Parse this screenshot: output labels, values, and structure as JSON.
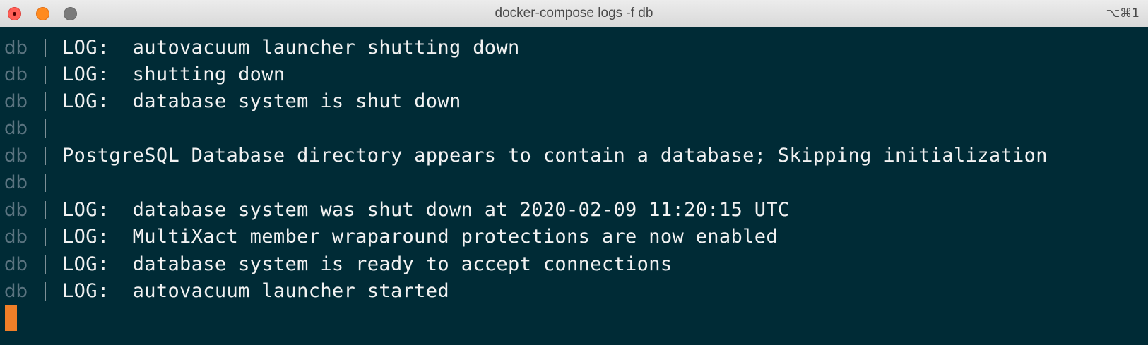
{
  "window": {
    "title": "docker-compose logs -f db",
    "shortcut": "⌥⌘1"
  },
  "colors": {
    "terminal_background": "#002b36",
    "text": "#f2f2f2",
    "service_prefix": "#5b7480",
    "cursor": "#f07f28"
  },
  "log": {
    "lines": [
      {
        "service": "db",
        "message": "LOG:  autovacuum launcher shutting down"
      },
      {
        "service": "db",
        "message": "LOG:  shutting down"
      },
      {
        "service": "db",
        "message": "LOG:  database system is shut down"
      },
      {
        "service": "db",
        "message": ""
      },
      {
        "service": "db",
        "message": "PostgreSQL Database directory appears to contain a database; Skipping initialization"
      },
      {
        "service": "db",
        "message": ""
      },
      {
        "service": "db",
        "message": "LOG:  database system was shut down at 2020-02-09 11:20:15 UTC"
      },
      {
        "service": "db",
        "message": "LOG:  MultiXact member wraparound protections are now enabled"
      },
      {
        "service": "db",
        "message": "LOG:  database system is ready to accept connections"
      },
      {
        "service": "db",
        "message": "LOG:  autovacuum launcher started"
      }
    ]
  }
}
